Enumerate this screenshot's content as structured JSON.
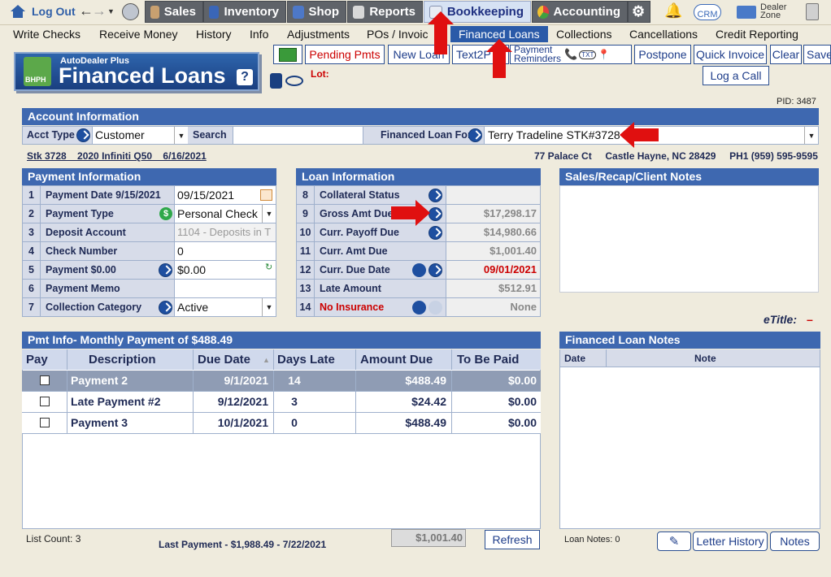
{
  "topnav": {
    "logout": "Log Out",
    "sales": "Sales",
    "inventory": "Inventory",
    "shop": "Shop",
    "reports": "Reports",
    "bookkeeping": "Bookkeeping",
    "accounting": "Accounting",
    "crm": "CRM",
    "dealer_zone_1": "Dealer",
    "dealer_zone_2": "Zone"
  },
  "menu": {
    "write_checks": "Write Checks",
    "receive_money": "Receive Money",
    "history": "History",
    "info": "Info",
    "adjustments": "Adjustments",
    "pos_invoices": "POs / Invoic",
    "financed_loans": "Financed Loans",
    "collections": "Collections",
    "cancellations": "Cancellations",
    "credit_reporting": "Credit Reporting"
  },
  "logo": {
    "brand": "AutoDealer Plus",
    "title": "Financed Loans",
    "badge": "BHPH",
    "help": "?"
  },
  "lot_label": "Lot:",
  "toolbar": {
    "pending_pmts": "Pending Pmts",
    "new_loan": "New Loan",
    "text2pay": "Text2P",
    "payment_reminders_1": "Payment",
    "payment_reminders_2": "Reminders",
    "txt": "TXT",
    "postpone": "Postpone",
    "quick_invoice": "Quick Invoice",
    "clear": "Clear",
    "save": "Save",
    "log_call": "Log a Call"
  },
  "pid": "PID: 3487",
  "account": {
    "header": "Account Information",
    "acct_type_label": "Acct Type",
    "acct_type_value": "Customer",
    "search_label": "Search",
    "financed_for_label": "Financed Loan For",
    "financed_for_value": "Terry Tradeline  STK#3728"
  },
  "vehicle_line": "Stk 3728    2020 Infiniti Q50    6/16/2021",
  "address_line": "77 Palace Ct     Castle Hayne, NC 28429     PH1 (959) 595-9595",
  "payment_info": {
    "header": "Payment Information",
    "rows": [
      {
        "num": "1",
        "label": "Payment Date  9/15/2021",
        "value": "09/15/2021"
      },
      {
        "num": "2",
        "label": "Payment Type",
        "value": "Personal Check"
      },
      {
        "num": "3",
        "label": "Deposit Account",
        "value": "1104 - Deposits in T"
      },
      {
        "num": "4",
        "label": "Check Number",
        "value": "0"
      },
      {
        "num": "5",
        "label": "Payment  $0.00",
        "value": "$0.00"
      },
      {
        "num": "6",
        "label": "Payment Memo",
        "value": ""
      },
      {
        "num": "7",
        "label": "Collection Category",
        "value": "Active"
      }
    ]
  },
  "loan_info": {
    "header": "Loan Information",
    "rows": [
      {
        "num": "8",
        "label": "Collateral Status",
        "value": ""
      },
      {
        "num": "9",
        "label": "Gross Amt Due",
        "value": "$17,298.17"
      },
      {
        "num": "10",
        "label": "Curr. Payoff Due",
        "value": "$14,980.66"
      },
      {
        "num": "11",
        "label": "Curr. Amt Due",
        "value": "$1,001.40"
      },
      {
        "num": "12",
        "label": "Curr. Due Date",
        "value": "09/01/2021"
      },
      {
        "num": "13",
        "label": "Late Amount",
        "value": "$512.91"
      },
      {
        "num": "14",
        "label": "No Insurance",
        "value": "None"
      }
    ]
  },
  "notes": {
    "header": "Sales/Recap/Client Notes",
    "etitle_label": "eTitle:",
    "etitle_value": "–"
  },
  "pmt_table": {
    "header": "Pmt Info- Monthly Payment of $488.49",
    "columns": [
      "Pay",
      "Description",
      "Due Date",
      "Days Late",
      "Amount Due",
      "To Be Paid"
    ],
    "rows": [
      {
        "desc": "Payment 2",
        "due": "9/1/2021",
        "late": "14",
        "amount": "$488.49",
        "tobepaid": "$0.00"
      },
      {
        "desc": "Late Payment #2",
        "due": "9/12/2021",
        "late": "3",
        "amount": "$24.42",
        "tobepaid": "$0.00"
      },
      {
        "desc": "Payment 3",
        "due": "10/1/2021",
        "late": "0",
        "amount": "$488.49",
        "tobepaid": "$0.00"
      }
    ]
  },
  "fl_notes": {
    "header": "Financed Loan Notes",
    "col_date": "Date",
    "col_note": "Note"
  },
  "footer": {
    "list_count": "List Count:  3",
    "last_payment": "Last Payment - $1,988.49 - 7/22/2021",
    "total": "$1,001.40",
    "refresh": "Refresh",
    "loan_notes": "Loan Notes:  0",
    "letter_history": "Letter History",
    "notes": "Notes"
  },
  "colors": {
    "accent": "#3e68b0",
    "alert": "#cc0000",
    "background": "#efebdd"
  }
}
